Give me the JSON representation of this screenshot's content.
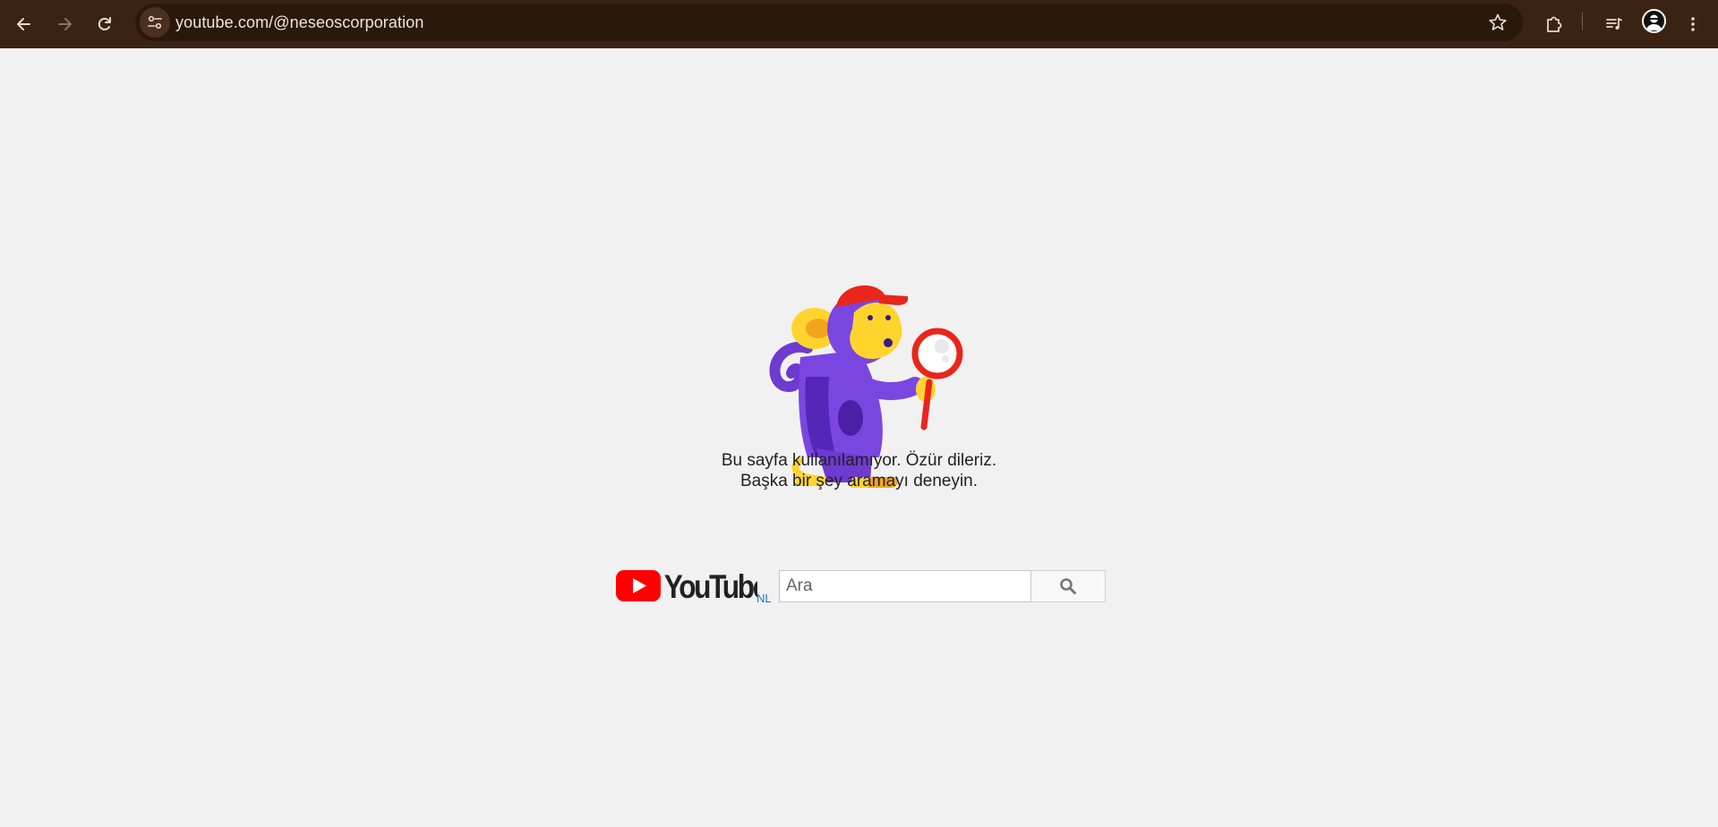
{
  "browser": {
    "url": "youtube.com/@neseoscorporation",
    "back_icon": "arrow-left-icon",
    "forward_icon": "arrow-right-icon",
    "reload_icon": "reload-icon",
    "site_info_icon": "tune-icon",
    "bookmark_icon": "star-icon",
    "extensions_icon": "puzzle-icon",
    "media_icon": "media-queue-icon",
    "menu_icon": "kebab-menu-icon"
  },
  "error_page": {
    "line1": "Bu sayfa kullanılamıyor. Özür dileriz.",
    "line2": "Başka bir şey aramayı deneyin.",
    "logo_country": "NL",
    "search_placeholder": "Ara",
    "colors": {
      "youtube_red": "#ff0000",
      "monkey_purple": "#6e3ad0",
      "monkey_yellow": "#ffd52d",
      "cap_red": "#e8261c"
    }
  }
}
